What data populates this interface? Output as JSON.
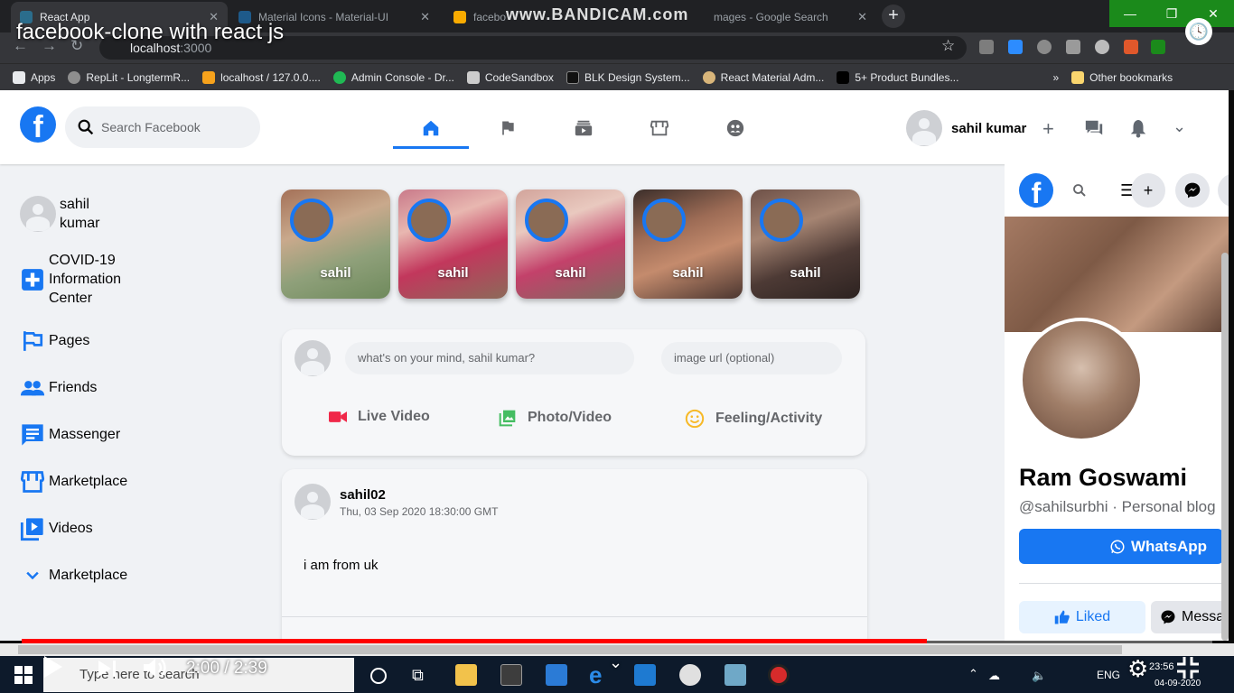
{
  "video": {
    "title": "facebook-clone with react js",
    "watermark": "www.BANDICAM.com",
    "time_current": "2:00",
    "time_total": "2:39",
    "time_separator": "/",
    "progress_fraction": 0.76
  },
  "browser": {
    "tabs": [
      {
        "label": "React App",
        "favicon_color": "#61dafb"
      },
      {
        "label": "Material Icons - Material-UI",
        "favicon_color": "#1e88e5"
      },
      {
        "label": "facebo",
        "favicon_color": "#f9ab00"
      },
      {
        "label": "mages - Google Search",
        "favicon_color": "#4285f4"
      }
    ],
    "url_host": "localhost",
    "url_port": ":3000",
    "bookmarks": [
      {
        "label": "Apps",
        "icon": "apps-grid-icon",
        "color": "#e8eaed"
      },
      {
        "label": "RepLit - LongtermR...",
        "icon": "replit-icon",
        "color": "#8e8e8e"
      },
      {
        "label": "localhost / 127.0.0....",
        "icon": "phpmyadmin-icon",
        "color": "#f6a21c"
      },
      {
        "label": "Admin Console - Dr...",
        "icon": "admin-console-icon",
        "color": "#20b954"
      },
      {
        "label": "CodeSandbox",
        "icon": "codesandbox-icon",
        "color": "#cccccc"
      },
      {
        "label": "BLK Design System...",
        "icon": "blk-icon",
        "color": "#111111"
      },
      {
        "label": "React Material Adm...",
        "icon": "react-material-icon",
        "color": "#d8b57a"
      },
      {
        "label": "5+ Product Bundles...",
        "icon": "bundles-icon",
        "color": "#000000"
      }
    ],
    "bookmarks_overflow": "»",
    "other_bookmarks": "Other bookmarks"
  },
  "fb": {
    "brand_color": "#1877f2",
    "search_placeholder": "Search Facebook",
    "user_name": "sahil kumar",
    "sidebar": [
      {
        "label": "sahil kumar",
        "icon": "avatar-icon"
      },
      {
        "label": "COVID-19 Information Center",
        "icon": "local-hospital-icon",
        "color": "#1877f2"
      },
      {
        "label": "Pages",
        "icon": "emoji-flags-icon",
        "color": "#1877f2"
      },
      {
        "label": "Friends",
        "icon": "people-icon",
        "color": "#1877f2"
      },
      {
        "label": "Massenger",
        "icon": "chat-icon",
        "color": "#1877f2"
      },
      {
        "label": "Marketplace",
        "icon": "storefront-icon",
        "color": "#1877f2"
      },
      {
        "label": "Videos",
        "icon": "video-library-icon",
        "color": "#1877f2"
      },
      {
        "label": "Marketplace",
        "icon": "expand-more-icon",
        "color": "#1877f2"
      }
    ],
    "stories": [
      {
        "name": "sahil"
      },
      {
        "name": "sahil"
      },
      {
        "name": "sahil"
      },
      {
        "name": "sahil"
      },
      {
        "name": "sahil"
      }
    ],
    "composer": {
      "message_placeholder": "what's on your mind, sahil kumar?",
      "image_placeholder": "image url (optional)",
      "live_video": "Live Video",
      "photo_video": "Photo/Video",
      "feeling": "Feeling/Activity"
    },
    "post": {
      "username": "sahil02",
      "timestamp": "Thu, 03 Sep 2020 18:30:00 GMT",
      "message": "i am from uk"
    },
    "page_widget": {
      "name": "Ram Goswami",
      "handle": "@sahilsurbhi · Personal blog",
      "whatsapp": "WhatsApp",
      "liked": "Liked",
      "message": "Messa"
    }
  },
  "taskbar": {
    "search_placeholder": "Type here to search",
    "language": "ENG",
    "clock_time": "23:56",
    "clock_date": "04-09-2020"
  }
}
